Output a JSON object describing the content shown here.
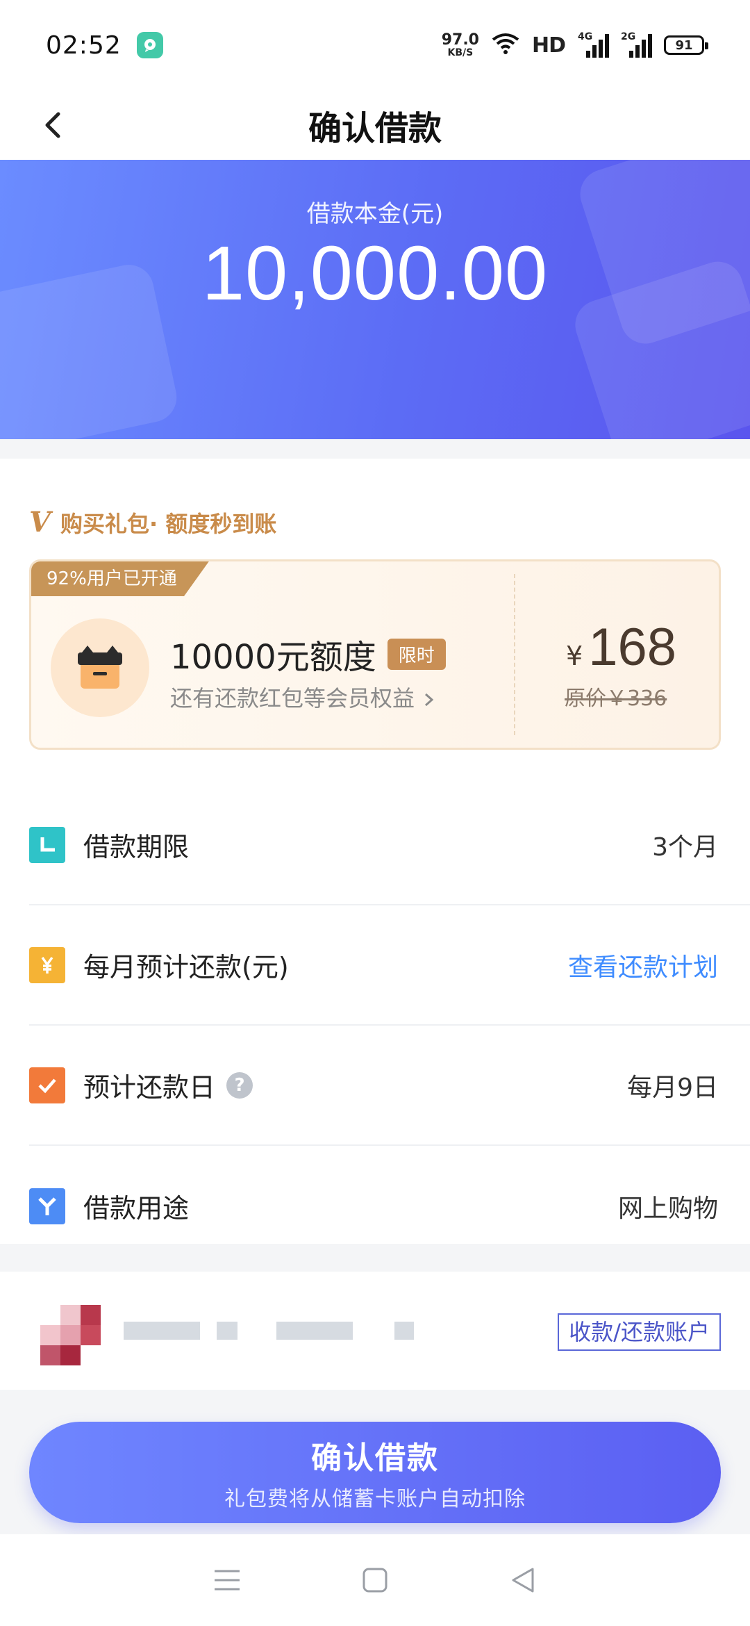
{
  "status_bar": {
    "time": "02:52",
    "net_speed_value": "97.0",
    "net_speed_unit": "KB/S",
    "hd_label": "HD",
    "signal1_label": "4G",
    "signal2_label": "2G",
    "battery": "91",
    "app_icon": "chat-bubble-icon"
  },
  "nav": {
    "title": "确认借款",
    "back_icon": "chevron-left-icon"
  },
  "hero": {
    "label": "借款本金(元)",
    "amount": "10,000.00",
    "gradient_colors": [
      "#6b8cff",
      "#5a55ee"
    ]
  },
  "promo": {
    "v_mark": "V",
    "tagline": "购买礼包· 额度秒到账",
    "ribbon": "92%用户已开通",
    "title": "10000元额度",
    "badge": "限时",
    "subtitle": "还有还款红包等会员权益",
    "currency": "¥",
    "price": "168",
    "original_price": "原价￥336",
    "accent_color": "#c98b4a"
  },
  "rows": [
    {
      "label": "借款期限",
      "value": "3个月",
      "icon": "clock-icon",
      "color": "#2fc3c8"
    },
    {
      "label": "每月预计还款(元)",
      "value": "查看还款计划",
      "icon": "yuan-icon",
      "color": "#f5b335",
      "link": true
    },
    {
      "label": "预计还款日",
      "value": "每月9日",
      "icon": "checkmark-icon",
      "color": "#f27a3a",
      "help": "?"
    },
    {
      "label": "借款用途",
      "value": "网上购物",
      "icon": "y-branch-icon",
      "color": "#4d8cf5"
    }
  ],
  "account": {
    "button": "收款/还款账户"
  },
  "confirm": {
    "title": "确认借款",
    "subtitle": "礼包费将从储蓄卡账户自动扣除"
  },
  "system_nav": {
    "menu_icon": "menu-icon",
    "home_icon": "home-square-icon",
    "back_icon": "back-triangle-icon"
  }
}
